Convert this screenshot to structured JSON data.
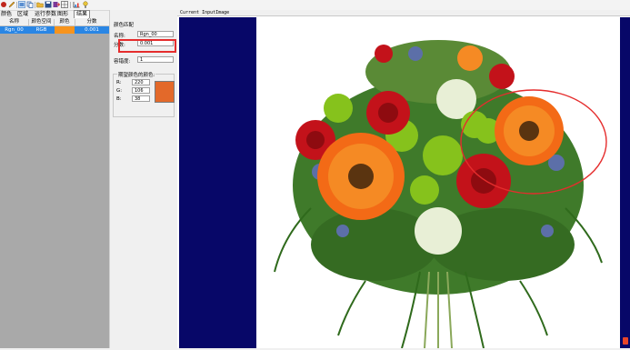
{
  "colors": {
    "target_color": "#e3692a",
    "row_swatch": "#f7941d",
    "selection_row": "#2a86e4",
    "display_bar": "#070768",
    "highlight": "#e52d2d"
  },
  "toolbar": {
    "icons": [
      "record-icon",
      "pencil-icon",
      "image-icon",
      "copy-icon",
      "folder-open-icon",
      "save-icon",
      "export-icon",
      "grid-icon",
      "chart-icon",
      "settings-icon"
    ]
  },
  "tabs": [
    "颜色",
    "区域",
    "运行参数",
    "图形",
    "结果"
  ],
  "grid": {
    "headers": [
      "名称",
      "颜色空间",
      "颜色",
      "分数"
    ],
    "row": {
      "name": "Rgn_00",
      "space": "RGB",
      "score": "0.001"
    }
  },
  "panel": {
    "title": "颜色匹配",
    "name_label": "名称:",
    "name_value": "Rgn_00",
    "score_label": "分数:",
    "score_value": "0.001",
    "tolerance_label": "容错度:",
    "tolerance_value": "1",
    "group_title": "期望颜色的颜色:",
    "r_label": "R:",
    "r_value": "220",
    "g_label": "G:",
    "g_value": "106",
    "b_label": "B:",
    "b_value": "38"
  },
  "viewer": {
    "title": "Current InputImage"
  }
}
